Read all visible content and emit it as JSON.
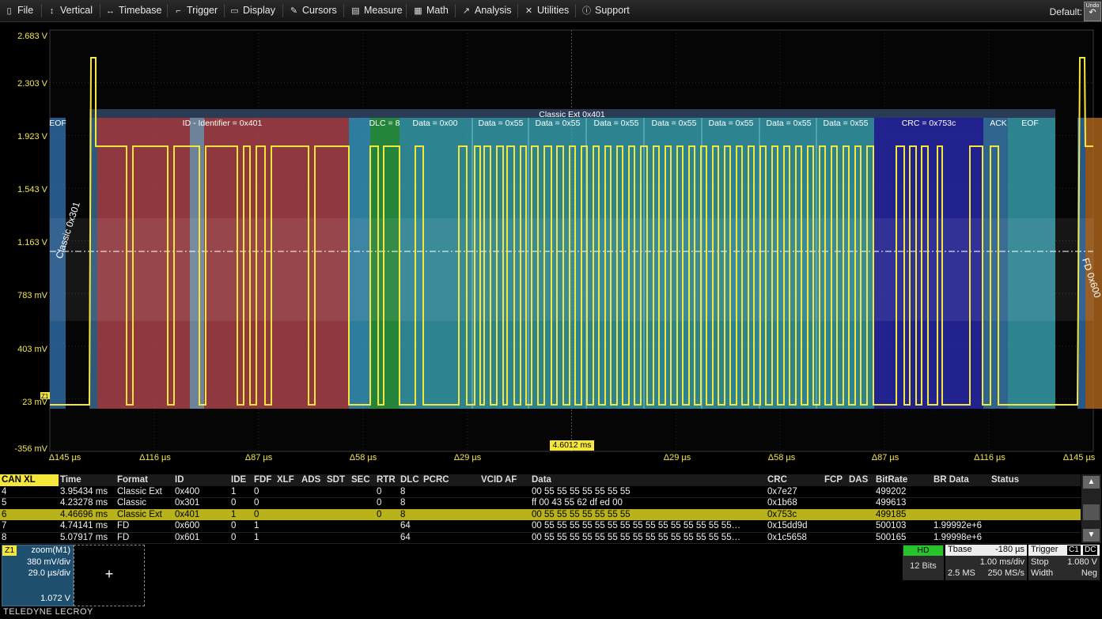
{
  "menu": {
    "file": "File",
    "vertical": "Vertical",
    "timebase": "Timebase",
    "trigger": "Trigger",
    "display": "Display",
    "cursors": "Cursors",
    "measure": "Measure",
    "math": "Math",
    "analysis": "Analysis",
    "utilities": "Utilities",
    "support": "Support",
    "default": "Default:",
    "undo": "Undo"
  },
  "y_axis": [
    "2.683 V",
    "2.303 V",
    "1.923 V",
    "1.543 V",
    "1.163 V",
    "783 mV",
    "403 mV",
    "23 mV",
    "-356 mV"
  ],
  "x_axis": [
    "Δ145 µs",
    "Δ116 µs",
    "Δ87 µs",
    "Δ58 µs",
    "Δ29 µs",
    "Δ29 µs",
    "Δ58 µs",
    "Δ87 µs",
    "Δ116 µs",
    "Δ145 µs"
  ],
  "channel_marker": "Z1",
  "cursor_delta": "4.6012 ms",
  "decode": {
    "frame_label": "Classic Ext 0x401",
    "left_frame_label": "Classic 0x301",
    "right_frame_label": "FD 0x600",
    "fields": [
      "EOF",
      "ID - Identifier = 0x401",
      "DLC = 8",
      "Data = 0x00",
      "Data = 0x55",
      "Data = 0x55",
      "Data = 0x55",
      "Data = 0x55",
      "Data = 0x55",
      "Data = 0x55",
      "Data = 0x55",
      "CRC = 0x753c",
      "ACK",
      "EOF"
    ]
  },
  "table": {
    "headers": [
      "CAN XL",
      "Time",
      "Format",
      "ID",
      "IDE",
      "FDF",
      "XLF",
      "ADS",
      "SDT",
      "SEC",
      "RTR",
      "DLC",
      "PCRC",
      "VCID",
      "AF",
      "Data",
      "CRC",
      "FCP",
      "DAS",
      "BitRate",
      "BR Data",
      "Status"
    ],
    "rows": [
      {
        "idx": "4",
        "time": "3.95434 ms",
        "format": "Classic Ext",
        "id": "0x400",
        "ide": "1",
        "fdf": "0",
        "rtr": "0",
        "dlc": "8",
        "data": "00 55 55 55 55 55 55 55",
        "crc": "0x7e27",
        "bitrate": "499202",
        "brdata": ""
      },
      {
        "idx": "5",
        "time": "4.23278 ms",
        "format": "Classic",
        "id": "0x301",
        "ide": "0",
        "fdf": "0",
        "rtr": "0",
        "dlc": "8",
        "data": "ff 00 43 55 62 df ed 00",
        "crc": "0x1b68",
        "bitrate": "499613",
        "brdata": ""
      },
      {
        "idx": "6",
        "time": "4.46696 ms",
        "format": "Classic Ext",
        "id": "0x401",
        "ide": "1",
        "fdf": "0",
        "rtr": "0",
        "dlc": "8",
        "data": "00 55 55 55 55 55 55 55",
        "crc": "0x753c",
        "bitrate": "499185",
        "brdata": ""
      },
      {
        "idx": "7",
        "time": "4.74141 ms",
        "format": "FD",
        "id": "0x600",
        "ide": "0",
        "fdf": "1",
        "rtr": "",
        "dlc": "64",
        "data": "00 55 55 55 55 55 55 55 55 55 55 55 55 55 55 55…",
        "crc": "0x15dd9d",
        "bitrate": "500103",
        "brdata": "1.99992e+6"
      },
      {
        "idx": "8",
        "time": "5.07917 ms",
        "format": "FD",
        "id": "0x601",
        "ide": "0",
        "fdf": "1",
        "rtr": "",
        "dlc": "64",
        "data": "00 55 55 55 55 55 55 55 55 55 55 55 55 55 55 55…",
        "crc": "0x1c5658",
        "bitrate": "500165",
        "brdata": "1.99998e+6"
      }
    ],
    "selected_index": 2
  },
  "zoom": {
    "tag": "Z1",
    "title": "zoom(M1)",
    "vdiv": "380 mV/div",
    "tdiv": "29.0 µs/div",
    "offset": "1.072 V"
  },
  "add_label": "+",
  "logo": "TELEDYNE LECROY",
  "hd": {
    "tag": "HD",
    "bits": "12 Bits"
  },
  "timebase": {
    "title": "Tbase",
    "delay": "-180 µs",
    "tdiv": "1.00 ms/div",
    "samples": "2.5 MS",
    "rate": "250 MS/s"
  },
  "trigger": {
    "title": "Trigger",
    "ch": "C1",
    "coupling": "DC",
    "mode": "Stop",
    "level": "1.080 V",
    "type": "Width",
    "slope": "Neg"
  },
  "colors": {
    "trace": "#f5e63c",
    "id_field": "#c9535a",
    "data_field": "#3aa7b8",
    "crc_field": "#2a2ab5",
    "dlc_field": "#2db34a"
  }
}
